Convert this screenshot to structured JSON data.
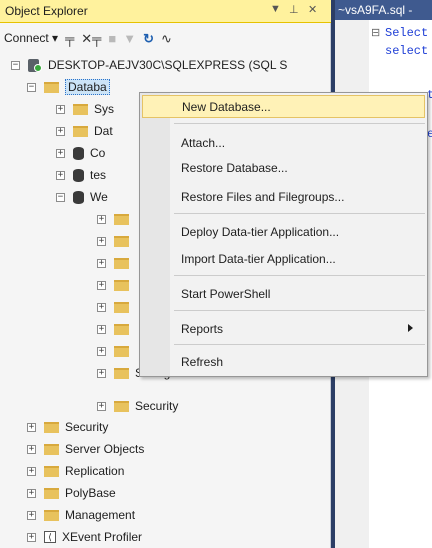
{
  "object_explorer": {
    "title": "Object Explorer",
    "pin_glyph": "⊥",
    "close_glyph": "✕",
    "toolbar": {
      "connect_label": "Connect ▾",
      "icons": [
        "connect-plug-icon",
        "disconnect-icon",
        "stop-icon",
        "filter-icon",
        "refresh-icon",
        "activity-monitor-icon"
      ]
    },
    "tree": {
      "server": "DESKTOP-AEJV30C\\SQLEXPRESS (SQL S",
      "databases": "Databa",
      "db_children": [
        "Sys",
        "Dat",
        "Co",
        "tes",
        "We"
      ],
      "we_children_last": [
        "Storage",
        "Security"
      ],
      "server_children": [
        "Security",
        "Server Objects",
        "Replication",
        "PolyBase",
        "Management",
        "XEvent Profiler"
      ]
    }
  },
  "editor": {
    "tab_title": "~vsA9FA.sql -",
    "lines": [
      "Select",
      "select",
      "t",
      "e"
    ]
  },
  "context_menu": {
    "items": [
      {
        "label": "New Database...",
        "highlighted": true
      },
      {
        "label": "Attach..."
      },
      {
        "label": "Restore Database..."
      },
      {
        "label": "Restore Files and Filegroups..."
      },
      {
        "label": "Deploy Data-tier Application..."
      },
      {
        "label": "Import Data-tier Application..."
      },
      {
        "label": "Start PowerShell"
      },
      {
        "label": "Reports",
        "submenu": true
      },
      {
        "label": "Refresh"
      }
    ]
  },
  "colors": {
    "title_bar": "#fff29d",
    "menu_highlight": "#fff2b7",
    "editor_tab": "#3f5a8f",
    "code_keyword": "#1f3fd6"
  }
}
